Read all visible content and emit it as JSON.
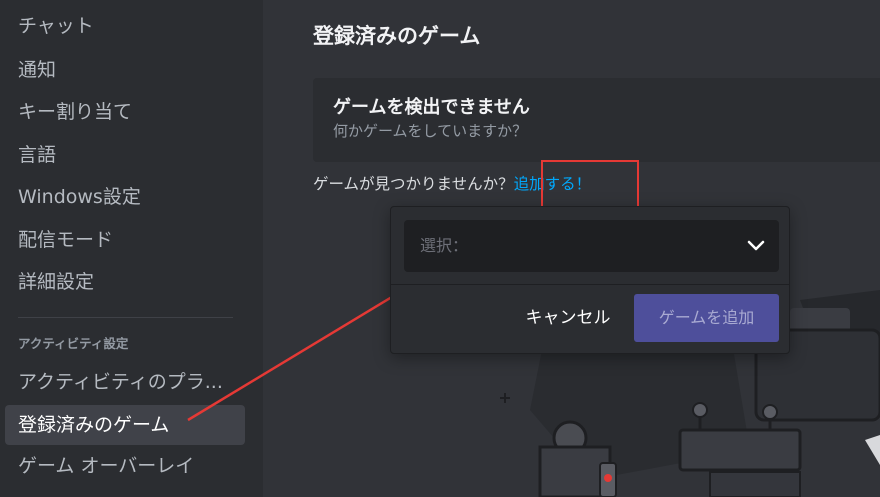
{
  "sidebar": {
    "items": [
      {
        "label": "チャット"
      },
      {
        "label": "通知"
      },
      {
        "label": "キー割り当て"
      },
      {
        "label": "言語"
      },
      {
        "label": "Windows設定"
      },
      {
        "label": "配信モード"
      },
      {
        "label": "詳細設定"
      }
    ],
    "activity_header": "アクティビティ設定",
    "activity_items": [
      {
        "label": "アクティビティのプラ..."
      },
      {
        "label": "登録済みのゲーム",
        "active": true
      },
      {
        "label": "ゲーム オーバーレイ"
      }
    ]
  },
  "main": {
    "title": "登録済みのゲーム",
    "detect_title": "ゲームを検出できません",
    "detect_subtitle": "何かゲームをしていますか？",
    "notfound_text": "ゲームが見つかりませんか？",
    "add_link": "追加する！"
  },
  "popup": {
    "select_placeholder": "選択：",
    "cancel_label": "キャンセル",
    "add_game_label": "ゲームを追加"
  },
  "colors": {
    "background": "#313338",
    "sidebar": "#2b2d31",
    "link": "#00a8fc",
    "primary_button": "#4e4f9b",
    "annotation_red": "#e53935"
  },
  "icons": [
    "chevron-down-icon",
    "annotation-arrow"
  ]
}
